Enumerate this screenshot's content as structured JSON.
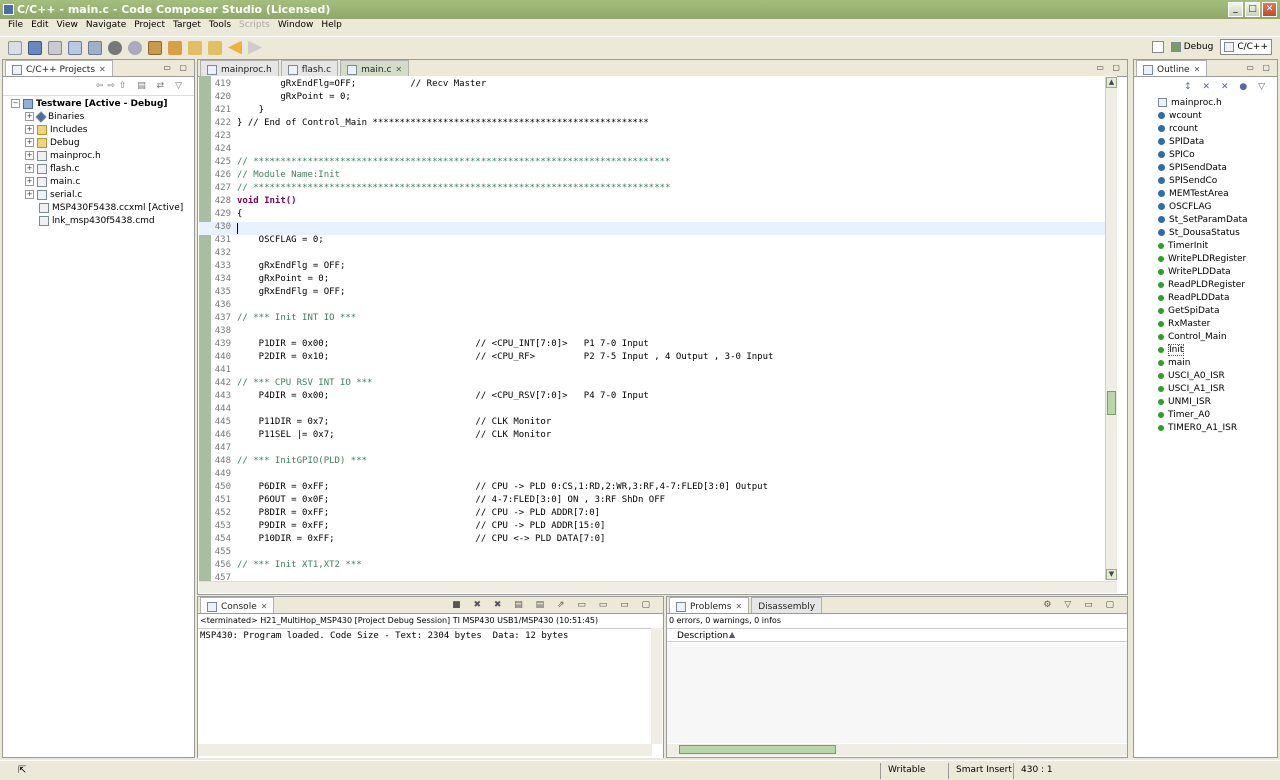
{
  "window": {
    "title": "C/C++ - main.c - Code Composer Studio (Licensed)"
  },
  "menu": [
    "File",
    "Edit",
    "View",
    "Navigate",
    "Project",
    "Target",
    "Tools",
    "Scripts",
    "Window",
    "Help"
  ],
  "perspectives": {
    "debug": "Debug",
    "cpp": "C/C++"
  },
  "projects_view": {
    "tab": "C/C++ Projects",
    "root": "Testware  [Active - Debug]",
    "items": [
      "Binaries",
      "Includes",
      "Debug",
      "mainproc.h",
      "flash.c",
      "main.c",
      "serial.c",
      "MSP430F5438.ccxml [Active]",
      "lnk_msp430f5438.cmd"
    ]
  },
  "editor": {
    "tabs": [
      "mainproc.h",
      "flash.c",
      "main.c"
    ],
    "active_tab": "main.c",
    "lines": [
      {
        "n": "419",
        "text": "        gRxEndFlg=OFF;          // Recv Master"
      },
      {
        "n": "420",
        "text": "        gRxPoint = 0;"
      },
      {
        "n": "421",
        "text": "    }"
      },
      {
        "n": "422",
        "text": "} // End of Control_Main ***************************************************"
      },
      {
        "n": "423",
        "text": ""
      },
      {
        "n": "424",
        "text": ""
      },
      {
        "n": "425",
        "text": "// *****************************************************************************"
      },
      {
        "n": "426",
        "text": "// Module Name:Init"
      },
      {
        "n": "427",
        "text": "// *****************************************************************************"
      },
      {
        "n": "428",
        "text": "void Init()"
      },
      {
        "n": "429",
        "text": "{"
      },
      {
        "n": "430",
        "text": ""
      },
      {
        "n": "431",
        "text": "    OSCFLAG = 0;"
      },
      {
        "n": "432",
        "text": ""
      },
      {
        "n": "433",
        "text": "    gRxEndFlg = OFF;"
      },
      {
        "n": "434",
        "text": "    gRxPoint = 0;"
      },
      {
        "n": "435",
        "text": "    gRxEndFlg = OFF;"
      },
      {
        "n": "436",
        "text": ""
      },
      {
        "n": "437",
        "text": "// *** Init INT IO ***"
      },
      {
        "n": "438",
        "text": ""
      },
      {
        "n": "439",
        "text": "    P1DIR = 0x00;                           // <CPU_INT[7:0]>   P1 7-0 Input"
      },
      {
        "n": "440",
        "text": "    P2DIR = 0x10;                           // <CPU_RF>         P2 7-5 Input , 4 Output , 3-0 Input"
      },
      {
        "n": "441",
        "text": ""
      },
      {
        "n": "442",
        "text": "// *** CPU RSV INT IO ***"
      },
      {
        "n": "443",
        "text": "    P4DIR = 0x00;                           // <CPU_RSV[7:0]>   P4 7-0 Input"
      },
      {
        "n": "444",
        "text": ""
      },
      {
        "n": "445",
        "text": "    P11DIR = 0x7;                           // CLK Monitor"
      },
      {
        "n": "446",
        "text": "    P11SEL |= 0x7;                          // CLK Monitor"
      },
      {
        "n": "447",
        "text": ""
      },
      {
        "n": "448",
        "text": "// *** InitGPIO(PLD) ***"
      },
      {
        "n": "449",
        "text": ""
      },
      {
        "n": "450",
        "text": "    P6DIR = 0xFF;                           // CPU -> PLD 0:CS,1:RD,2:WR,3:RF,4-7:FLED[3:0] Output"
      },
      {
        "n": "451",
        "text": "    P6OUT = 0x0F;                           // 4-7:FLED[3:0] ON , 3:RF ShDn OFF"
      },
      {
        "n": "452",
        "text": "    P8DIR = 0xFF;                           // CPU -> PLD ADDR[7:0]"
      },
      {
        "n": "453",
        "text": "    P9DIR = 0xFF;                           // CPU -> PLD ADDR[15:0]"
      },
      {
        "n": "454",
        "text": "    P10DIR = 0xFF;                          // CPU <-> PLD DATA[7:0]"
      },
      {
        "n": "455",
        "text": ""
      },
      {
        "n": "456",
        "text": "// *** Init XT1,XT2 ***"
      },
      {
        "n": "457",
        "text": ""
      }
    ]
  },
  "outline": {
    "tab": "Outline",
    "items": [
      "mainproc.h",
      "wcount",
      "rcount",
      "SPIData",
      "SPICo",
      "SPISendData",
      "SPISendCo",
      "MEMTestArea",
      "OSCFLAG",
      "St_SetParamData",
      "St_DousaStatus",
      "TimerInit",
      "WritePLDRegister",
      "WritePLDData",
      "ReadPLDRegister",
      "ReadPLDData",
      "GetSpiData",
      "RxMaster",
      "Control_Main",
      "Init",
      "main",
      "USCI_A0_ISR",
      "USCI_A1_ISR",
      "UNMI_ISR",
      "Timer_A0",
      "TIMER0_A1_ISR"
    ]
  },
  "console": {
    "tab": "Console",
    "header": "<terminated> H21_MultiHop_MSP430 [Project Debug Session] TI MSP430 USB1/MSP430 (10:51:45)",
    "output": "MSP430: Program loaded. Code Size - Text: 2304 bytes  Data: 12 bytes"
  },
  "problems": {
    "tabs": [
      "Problems",
      "Disassembly"
    ],
    "summary": "0 errors, 0 warnings, 0 infos",
    "column": "Description"
  },
  "status": {
    "writable": "Writable",
    "insert_mode": "Smart Insert",
    "position": "430 : 1"
  }
}
